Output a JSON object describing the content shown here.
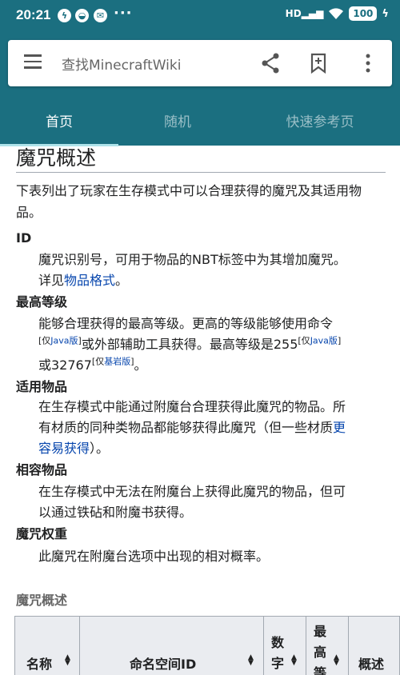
{
  "status_bar": {
    "time": "20:21",
    "battery": "100",
    "signal": "HD"
  },
  "search": {
    "placeholder": "查找MinecraftWiki"
  },
  "tabs": [
    {
      "label": "首页",
      "active": true
    },
    {
      "label": "随机",
      "active": false
    },
    {
      "label": "快速参考页",
      "active": false
    }
  ],
  "article": {
    "heading": "魔咒概述",
    "intro": "下表列出了玩家在生存模式中可以合理获得的魔咒及其适用物品。",
    "terms": [
      {
        "term": "ID",
        "desc_lines": [
          "魔咒识别号，可用于物品的NBT标签中为其增加魔咒。",
          "详见"
        ],
        "link": "物品格式",
        "tail": "。"
      },
      {
        "term": "最高等级",
        "line1": "能够合理获得的最高等级。更高的等级能够使用命令",
        "sup1_pre": "[仅",
        "sup1_link": "Java版",
        "sup1_post": "]",
        "mid": "或外部辅助工具获得。最高等级是255",
        "sup2_pre": "[仅",
        "sup2_link": "Java版",
        "sup2_post": "]",
        "line3": "或32767",
        "sup3_pre": "[仅",
        "sup3_link": "基岩版",
        "sup3_post": "]",
        "tail": "。"
      },
      {
        "term": "适用物品",
        "line1": "在生存模式中能通过附魔台合理获得此魔咒的物品。所",
        "line2": "有材质的同种类物品都能够获得此魔咒（但一些材质",
        "link1": "更",
        "link2": "容易获得",
        "tail": "）。"
      },
      {
        "term": "相容物品",
        "line1": "在生存模式中无法在附魔台上获得此魔咒的物品，但可",
        "line2": "以通过铁砧和附魔书获得。"
      },
      {
        "term": "魔咒权重",
        "line1": "此魔咒在附魔台选项中出现的相对概率。"
      }
    ],
    "table_caption": "魔咒概述",
    "table_headers": [
      "名称",
      "命名空间ID",
      "数字",
      "最高等",
      "概述"
    ]
  },
  "colors": {
    "header": "#1b6f80",
    "link": "#0645ad",
    "table_header_bg": "#eaecf0"
  }
}
